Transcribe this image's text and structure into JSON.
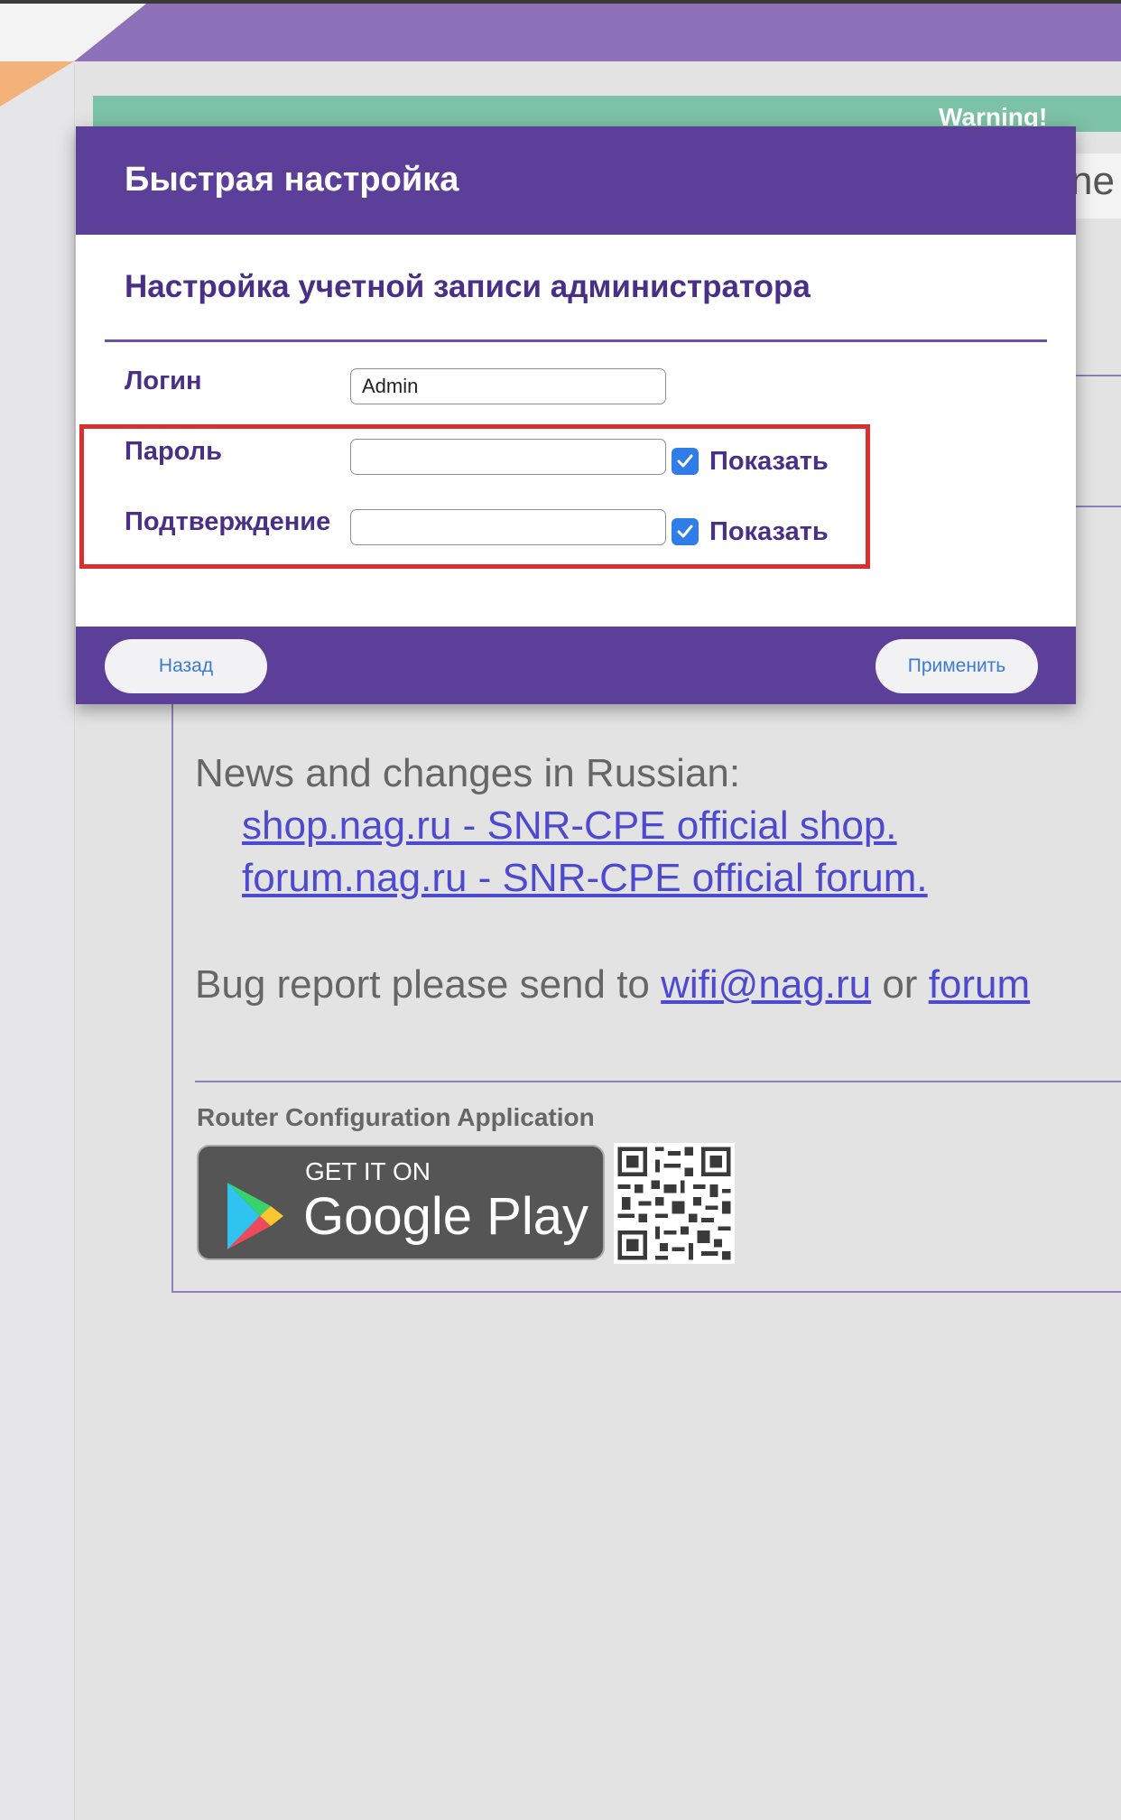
{
  "background": {
    "warning_text": "Warning!",
    "tab_fragment": "ne",
    "news": {
      "intro": "News and changes in Russian:",
      "links": [
        "shop.nag.ru - SNR-CPE official shop.",
        "forum.nag.ru - SNR-CPE official forum."
      ]
    },
    "bug_report": {
      "prefix": "Bug report please send to ",
      "email": "wifi@nag.ru",
      "middle": " or ",
      "forum": "forum"
    },
    "app_section": {
      "label": "Router Configuration Application",
      "badge_small": "GET IT ON",
      "badge_large": "Google Play"
    }
  },
  "modal": {
    "title": "Быстрая настройка",
    "section_title": "Настройка учетной записи администратора",
    "fields": {
      "login": {
        "label": "Логин",
        "value": "Admin"
      },
      "password": {
        "label": "Пароль",
        "value": "",
        "show_label": "Показать",
        "show_checked": true
      },
      "confirm": {
        "label": "Подтверждение",
        "value": "",
        "show_label": "Показать",
        "show_checked": true
      }
    },
    "buttons": {
      "back": "Назад",
      "apply": "Применить"
    }
  },
  "colors": {
    "header_purple": "#5c3f99",
    "label_purple": "#4a2f86",
    "highlight_red": "#d8302f",
    "warning_green": "#7cc2a6",
    "checkbox_blue": "#2f7de6"
  },
  "icons": [
    "checkmark-icon",
    "google-play-logo-icon",
    "qr-code-icon"
  ]
}
